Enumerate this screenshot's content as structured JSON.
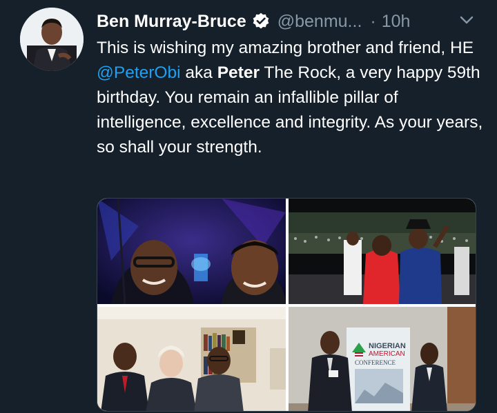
{
  "tweet": {
    "author_name": "Ben Murray-Bruce",
    "handle": "@benmu...",
    "separator": "·",
    "time": "10h",
    "text_parts": [
      "This is wishing my amazing brother and friend, HE ",
      "@PeterObi",
      " aka ",
      "Peter",
      " The Rock, a very happy 59th birthday. You remain an infallible pillar of intelligence, excellence and integrity. As your years, so shall your strength."
    ]
  },
  "icons": {
    "verified": "verified-badge-icon",
    "menu": "chevron-down-icon"
  },
  "banner": {
    "line1": "NIGERIAN",
    "line2": "AMERICAN",
    "line3": "CONFERENCE"
  },
  "colors": {
    "background": "#15202b",
    "text": "#ffffff",
    "secondary": "#8899a6",
    "link": "#1da1f2",
    "border": "#38444d"
  }
}
